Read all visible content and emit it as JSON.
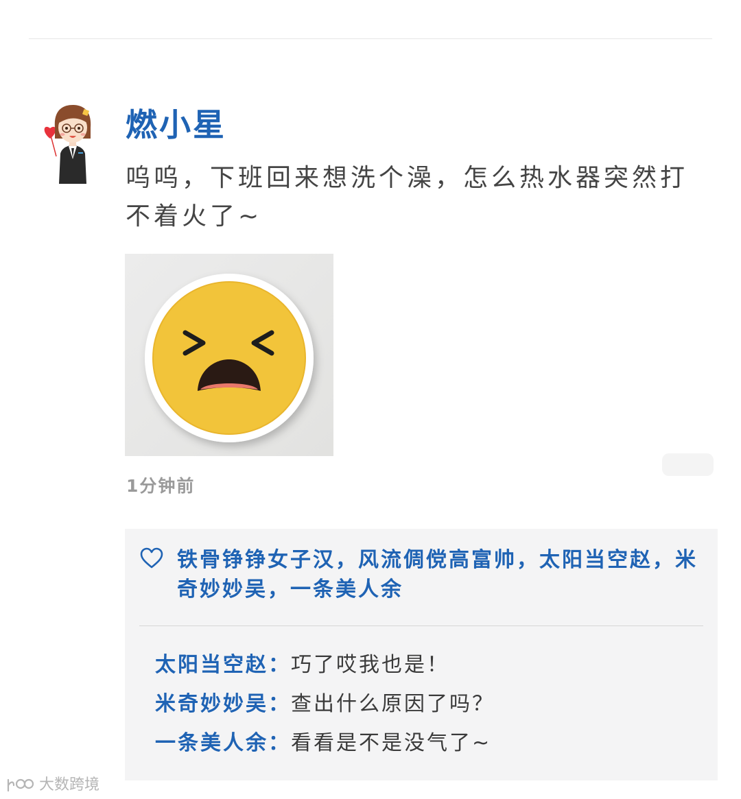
{
  "post": {
    "author": "燃小星",
    "text": "呜呜，下班回来想洗个澡，怎么热水器突然打不着火了~",
    "time": "1分钟前"
  },
  "likes": {
    "names": "铁骨铮铮女子汉，风流倜傥高富帅，太阳当空赵，米奇妙妙吴，一条美人余"
  },
  "comments": [
    {
      "author": "太阳当空赵",
      "sep": "：",
      "text": "巧了哎我也是！"
    },
    {
      "author": "米奇妙妙吴",
      "sep": "：",
      "text": "查出什么原因了吗？"
    },
    {
      "author": "一条美人余",
      "sep": "：",
      "text": "看看是不是没气了~"
    }
  ],
  "watermark": {
    "text": "大数跨境"
  },
  "colors": {
    "name_blue": "#1f63b4",
    "emoji_yellow": "#f2c43a",
    "panel_bg": "#f4f4f5"
  },
  "icons": {
    "like": "heart-outline-icon",
    "photo": "tired-face-emoji-icon",
    "avatar": "cartoon-woman-avatar-icon"
  }
}
